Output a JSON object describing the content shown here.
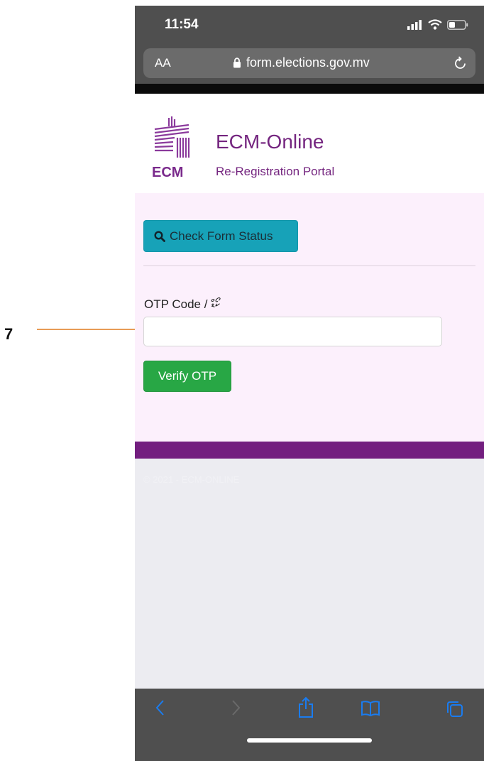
{
  "annotation": {
    "number": "7"
  },
  "status_bar": {
    "time": "11:54"
  },
  "browser": {
    "aa_label": "AA",
    "url": "form.elections.gov.mv"
  },
  "site": {
    "logo_text": "ECM",
    "title": "ECM-Online",
    "subtitle": "Re-Registration Portal"
  },
  "form": {
    "check_status_label": "Check Form Status",
    "otp_label": "OTP Code / ކޯޑް",
    "otp_value": "",
    "verify_label": "Verify OTP"
  },
  "footer": {
    "text": "© 2021 - ECM-ONLINE"
  },
  "colors": {
    "brand_purple": "#731e7f",
    "info_button": "#17a2b8",
    "success_button": "#28a745",
    "annotation_arrow": "#e07a1f",
    "toolbar_icon": "#1a7cf0"
  }
}
